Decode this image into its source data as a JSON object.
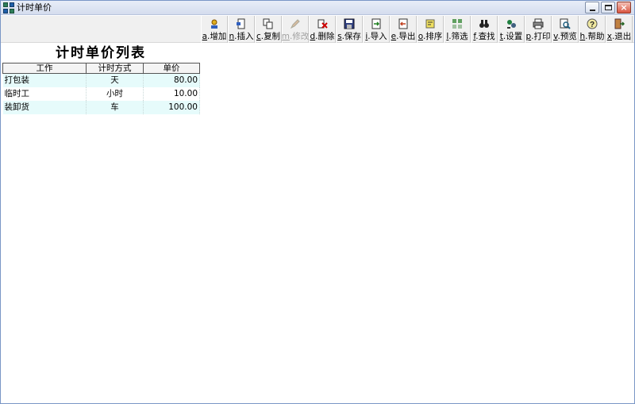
{
  "window": {
    "title": "计时单价"
  },
  "toolbar": {
    "buttons": [
      {
        "key": "a",
        "label": "增加",
        "icon": "add-user-icon",
        "enabled": true
      },
      {
        "key": "n",
        "label": "插入",
        "icon": "insert-icon",
        "enabled": true
      },
      {
        "key": "c",
        "label": "复制",
        "icon": "copy-icon",
        "enabled": true
      },
      {
        "key": "m",
        "label": "修改",
        "icon": "edit-icon",
        "enabled": false
      },
      {
        "key": "d",
        "label": "删除",
        "icon": "delete-icon",
        "enabled": true
      },
      {
        "key": "s",
        "label": "保存",
        "icon": "save-icon",
        "enabled": true
      },
      {
        "key": "i",
        "label": "导入",
        "icon": "import-icon",
        "enabled": true
      },
      {
        "key": "e",
        "label": "导出",
        "icon": "export-icon",
        "enabled": true
      },
      {
        "key": "o",
        "label": "排序",
        "icon": "sort-icon",
        "enabled": true
      },
      {
        "key": "l",
        "label": "筛选",
        "icon": "filter-icon",
        "enabled": true
      },
      {
        "key": "f",
        "label": "查找",
        "icon": "binoculars-icon",
        "enabled": true
      },
      {
        "key": "t",
        "label": "设置",
        "icon": "settings-icon",
        "enabled": true
      },
      {
        "key": "p",
        "label": "打印",
        "icon": "printer-icon",
        "enabled": true
      },
      {
        "key": "v",
        "label": "预览",
        "icon": "preview-icon",
        "enabled": true
      },
      {
        "key": "h",
        "label": "帮助",
        "icon": "help-icon",
        "enabled": true
      },
      {
        "key": "x",
        "label": "退出",
        "icon": "exit-icon",
        "enabled": true
      }
    ]
  },
  "report": {
    "title": "计时单价列表",
    "columns": [
      "工作",
      "计时方式",
      "单价"
    ],
    "rows": [
      {
        "work": "打包装",
        "mode": "天",
        "price": "80.00"
      },
      {
        "work": "临时工",
        "mode": "小时",
        "price": "10.00"
      },
      {
        "work": "装卸货",
        "mode": "车",
        "price": "100.00"
      }
    ]
  }
}
